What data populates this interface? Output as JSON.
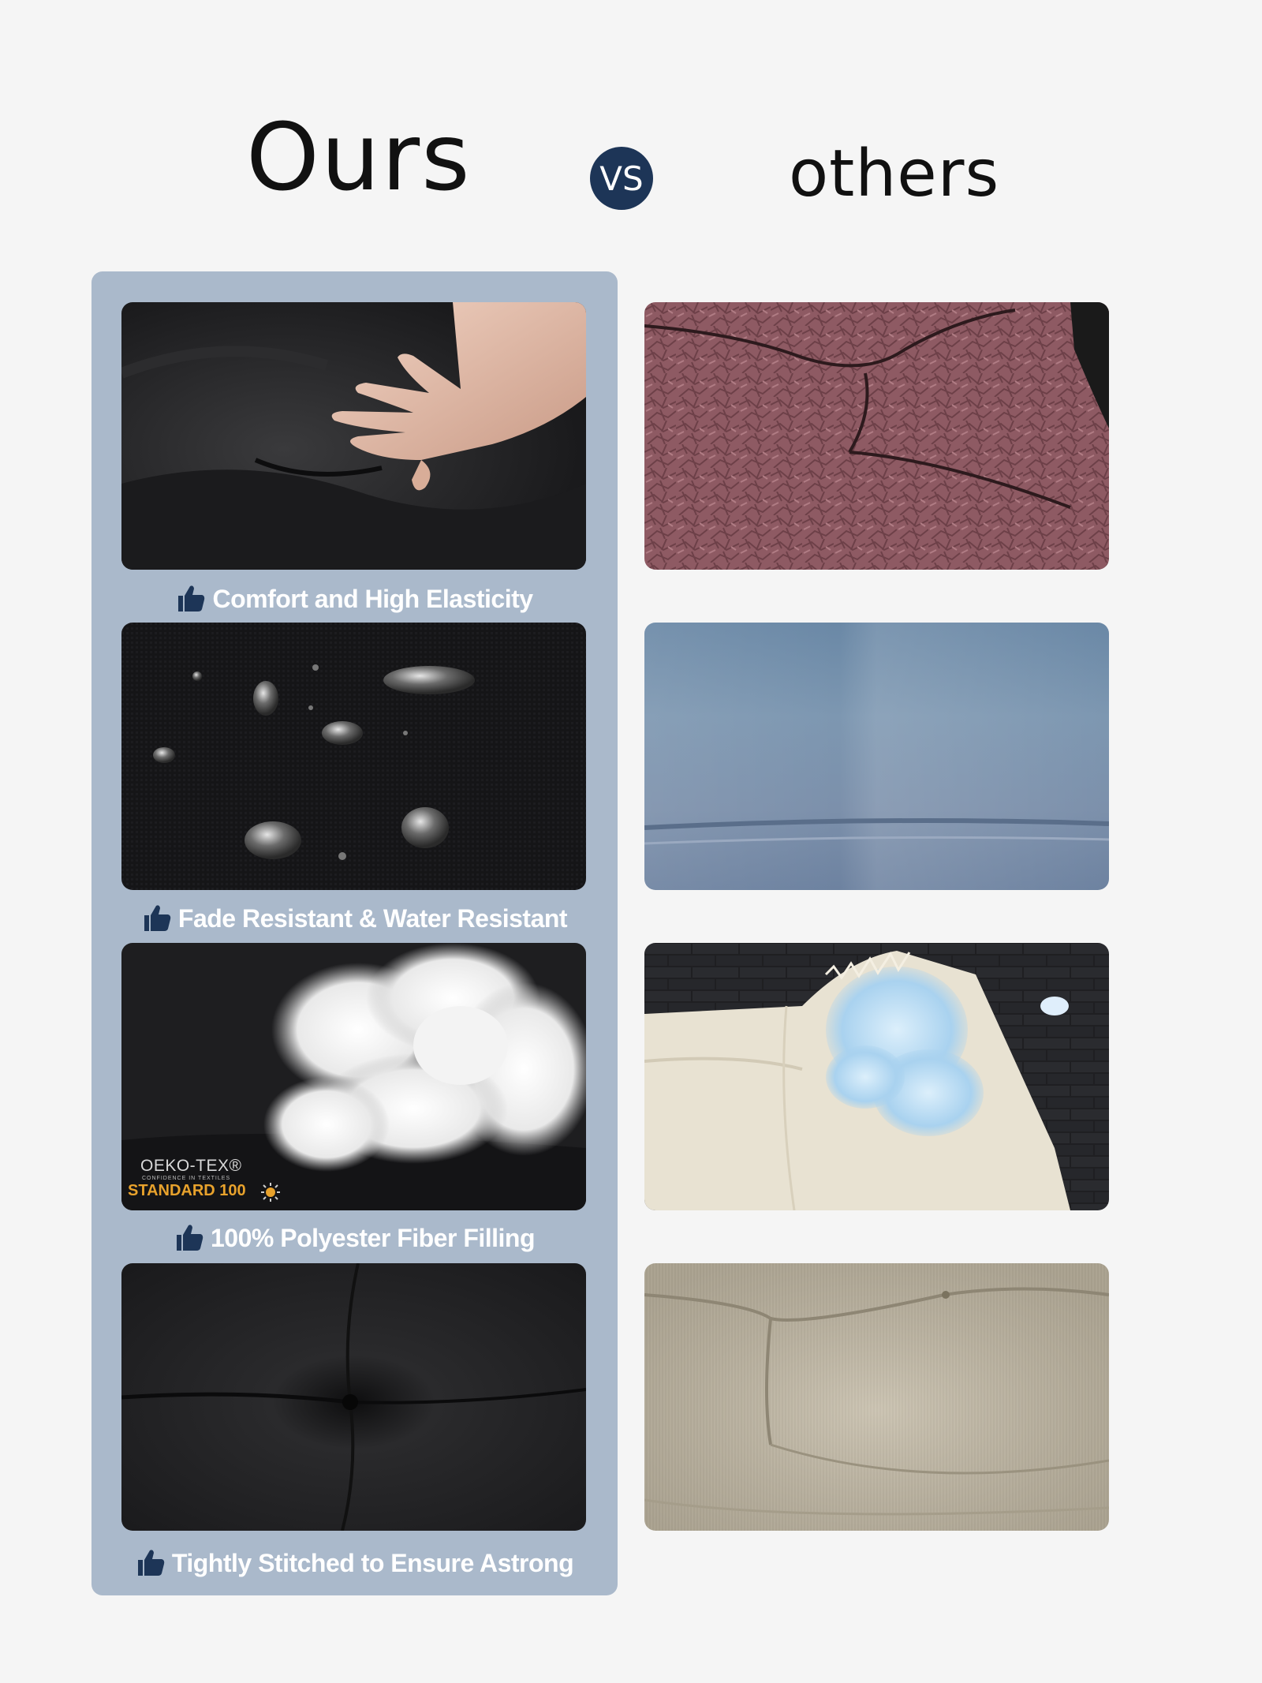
{
  "header": {
    "ours_label": "Ours",
    "vs_label": "VS",
    "others_label": "others"
  },
  "features": [
    {
      "caption": "Comfort and High Elasticity",
      "icon": "thumbs-up-icon"
    },
    {
      "caption": "Fade Resistant & Water Resistant",
      "icon": "thumbs-up-icon"
    },
    {
      "caption": "100% Polyester Fiber Filling",
      "icon": "thumbs-up-icon"
    },
    {
      "caption": "Tightly Stitched to Ensure Astrong",
      "icon": "thumbs-up-icon"
    }
  ],
  "certification": {
    "name": "OEKO-TEX®",
    "tagline": "CONFIDENCE IN TEXTILES",
    "standard": "STANDARD 100"
  },
  "colors": {
    "panel": "#aab9cb",
    "badge": "#1d3557",
    "oeko_accent": "#e8a22c"
  }
}
